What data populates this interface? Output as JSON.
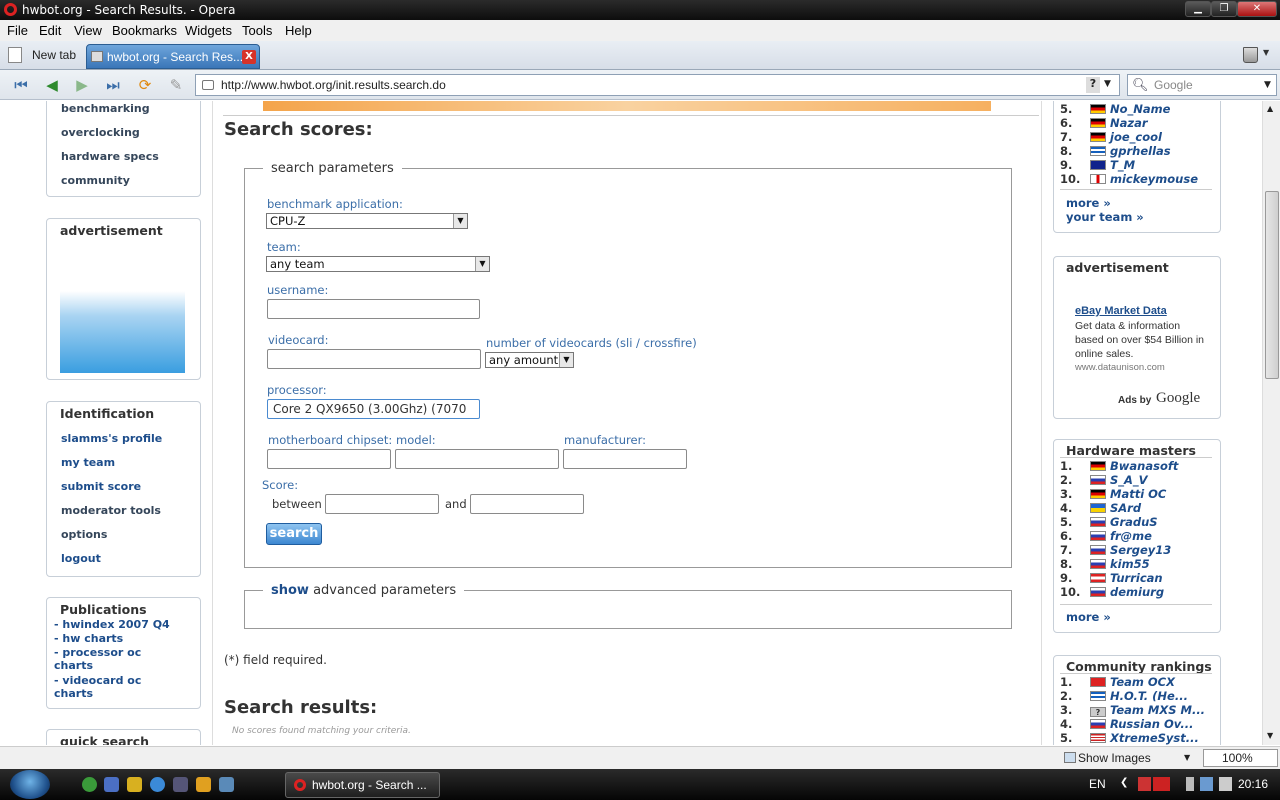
{
  "window": {
    "title": "hwbot.org - Search Results. - Opera"
  },
  "menu": [
    "File",
    "Edit",
    "View",
    "Bookmarks",
    "Widgets",
    "Tools",
    "Help"
  ],
  "tabs": {
    "new_tab": "New tab",
    "active": "hwbot.org - Search Res..."
  },
  "address": {
    "url": "http://www.hwbot.org/init.results.search.do",
    "search_placeholder": "Google"
  },
  "left": {
    "nav_top": [
      "benchmarking",
      "overclocking",
      "hardware specs",
      "community"
    ],
    "ad_title": "advertisement",
    "identification": {
      "title": "Identification",
      "items": [
        "slamms's profile",
        "my team",
        "submit score",
        "moderator tools",
        "options",
        "logout"
      ]
    },
    "publications": {
      "title": "Publications",
      "items": [
        "- hwindex 2007 Q4",
        "- hw charts",
        "- processor oc charts",
        "- videocard oc charts"
      ]
    },
    "quick_search": "quick search"
  },
  "center": {
    "title": "Search scores:",
    "legend": "search parameters",
    "benchmark_label": "benchmark application:",
    "benchmark_value": "CPU-Z",
    "team_label": "team:",
    "team_value": "any team",
    "username_label": "username:",
    "videocard_label": "videocard:",
    "num_videocards_label": "number of videocards (sli / crossfire)",
    "num_videocards_value": "any amount",
    "processor_label": "processor:",
    "processor_value": "Core 2 QX9650 (3.00Ghz) (7070",
    "chipset_label": "motherboard chipset:",
    "model_label": "model:",
    "manufacturer_label": "manufacturer:",
    "score_label": "Score:",
    "between_label": "between",
    "and_label": "and",
    "search_button": "search",
    "advanced_show": "show",
    "advanced_rest": "advanced parameters",
    "required_note": "(*) field required.",
    "results_title": "Search results:",
    "no_results": "No scores found matching your criteria."
  },
  "right": {
    "top_list": [
      {
        "rank": "5.",
        "name": "No_Name",
        "flag": "de"
      },
      {
        "rank": "6.",
        "name": "Nazar",
        "flag": "de"
      },
      {
        "rank": "7.",
        "name": "joe_cool",
        "flag": "de"
      },
      {
        "rank": "8.",
        "name": "gprhellas",
        "flag": "gr"
      },
      {
        "rank": "9.",
        "name": "T_M",
        "flag": "au"
      },
      {
        "rank": "10.",
        "name": "mickeymouse",
        "flag": "uk"
      }
    ],
    "top_more": "more »",
    "your_team": "your team »",
    "ad_title": "advertisement",
    "ad_link": "eBay Market Data",
    "ad_text": "Get data & information based on over $54 Billion in online sales.",
    "ad_url": "www.dataunison.com",
    "ads_by": "Ads by",
    "ads_google": "Google",
    "hw_masters": {
      "title": "Hardware masters",
      "items": [
        {
          "rank": "1.",
          "name": "Bwanasoft",
          "flag": "de"
        },
        {
          "rank": "2.",
          "name": "S_A_V",
          "flag": "ru"
        },
        {
          "rank": "3.",
          "name": "Matti OC",
          "flag": "de"
        },
        {
          "rank": "4.",
          "name": "SArd",
          "flag": "ua"
        },
        {
          "rank": "5.",
          "name": "GraduS",
          "flag": "ru"
        },
        {
          "rank": "6.",
          "name": "fr@me",
          "flag": "ru"
        },
        {
          "rank": "7.",
          "name": "Sergey13",
          "flag": "ru"
        },
        {
          "rank": "8.",
          "name": "kim55",
          "flag": "ru"
        },
        {
          "rank": "9.",
          "name": "Turrican",
          "flag": "at"
        },
        {
          "rank": "10.",
          "name": "demiurg",
          "flag": "ru"
        }
      ],
      "more": "more »"
    },
    "community": {
      "title": "Community rankings",
      "items": [
        {
          "rank": "1.",
          "name": "Team OCX",
          "flag": "tw"
        },
        {
          "rank": "2.",
          "name": "H.O.T. (He...",
          "flag": "gr"
        },
        {
          "rank": "3.",
          "name": "Team MXS M...",
          "flag": "unknown"
        },
        {
          "rank": "4.",
          "name": "Russian Ov...",
          "flag": "ru"
        },
        {
          "rank": "5.",
          "name": "XtremeSyst...",
          "flag": "us"
        }
      ]
    }
  },
  "status": {
    "show_images": "Show Images",
    "zoom": "100%"
  },
  "taskbar": {
    "task": "hwbot.org - Search ...",
    "lang": "EN",
    "clock": "20:16"
  },
  "colors": {
    "link": "#1d4d8b",
    "label": "#3b6ea8",
    "button": "#3d87d1"
  }
}
